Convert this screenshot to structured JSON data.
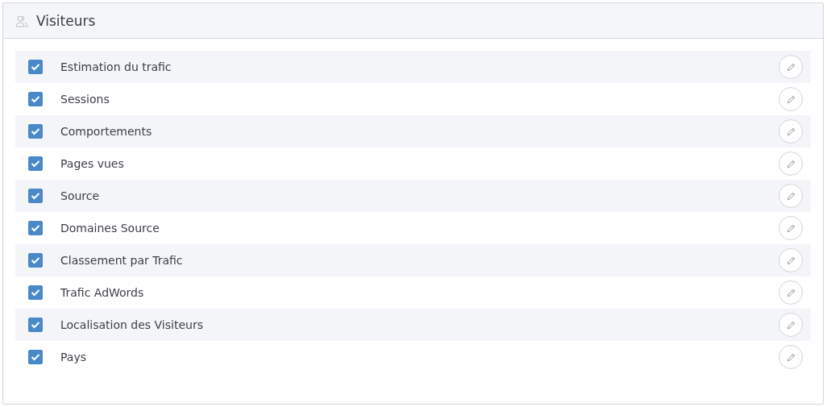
{
  "panel": {
    "title": "Visiteurs"
  },
  "items": [
    {
      "label": "Estimation du trafic",
      "checked": true
    },
    {
      "label": "Sessions",
      "checked": true
    },
    {
      "label": "Comportements",
      "checked": true
    },
    {
      "label": "Pages vues",
      "checked": true
    },
    {
      "label": "Source",
      "checked": true
    },
    {
      "label": "Domaines Source",
      "checked": true
    },
    {
      "label": "Classement par Trafic",
      "checked": true
    },
    {
      "label": "Trafic AdWords",
      "checked": true
    },
    {
      "label": "Localisation des Visiteurs",
      "checked": true
    },
    {
      "label": "Pays",
      "checked": true
    }
  ]
}
